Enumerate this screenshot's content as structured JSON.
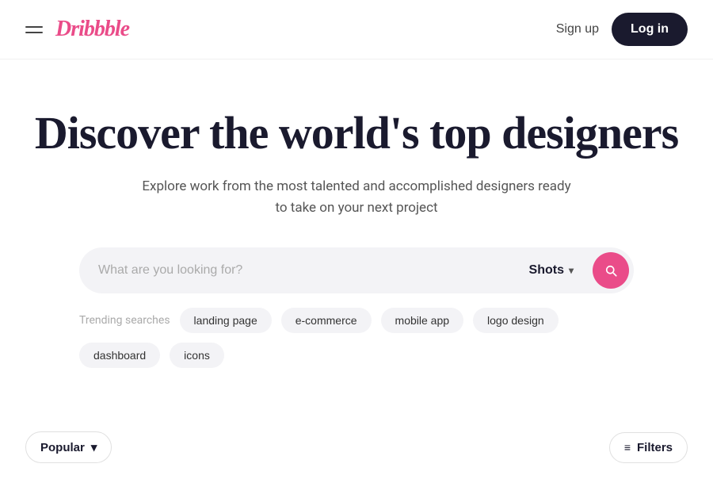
{
  "header": {
    "logo": "Dribbble",
    "sign_up_label": "Sign up",
    "log_in_label": "Log in"
  },
  "hero": {
    "title": "Discover the world's top designers",
    "subtitle": "Explore work from the most talented and accomplished designers ready to take on your next project"
  },
  "search": {
    "placeholder": "What are you looking for?",
    "dropdown_label": "Shots",
    "button_aria": "Search"
  },
  "trending": {
    "label": "Trending searches",
    "tags": [
      "landing page",
      "e-commerce",
      "mobile app",
      "logo design",
      "dashboard",
      "icons"
    ]
  },
  "bottom_bar": {
    "popular_label": "Popular",
    "filters_label": "Filters"
  },
  "colors": {
    "brand_pink": "#ea4c89",
    "dark_navy": "#1a1a2e"
  }
}
